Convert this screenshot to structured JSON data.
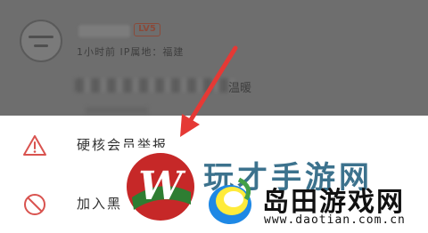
{
  "comment": {
    "level_badge": "LV5",
    "meta": "1小时前 IP属地：福建",
    "text_tail": "温暖"
  },
  "action_sheet": {
    "items": [
      {
        "label": "硬核会员举报",
        "icon": "warning-triangle-icon"
      },
      {
        "label": "加入黑",
        "icon": "block-circle-icon"
      }
    ]
  },
  "watermark": {
    "background_text": "玩才手游网",
    "site_name": "岛田游戏网",
    "url": "www.daotian.com.cn"
  },
  "colors": {
    "arrow": "#e53935",
    "icon_red": "#d9534f",
    "logo_red": "#c62828",
    "logo_green": "#2e7d32"
  }
}
